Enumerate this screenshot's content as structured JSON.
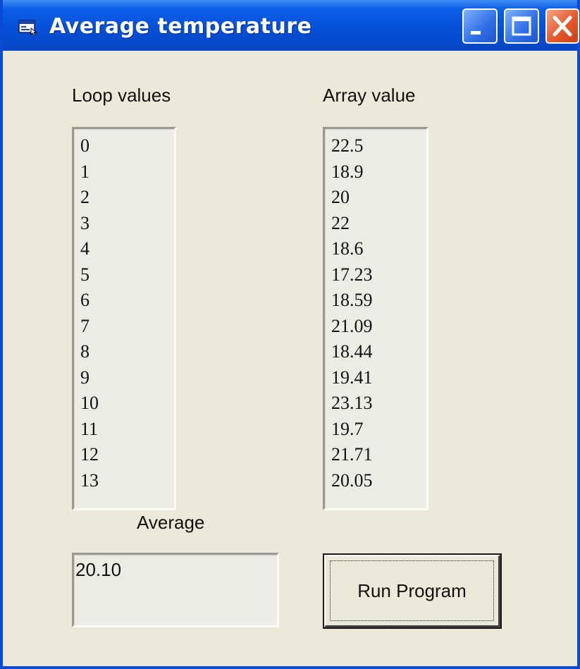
{
  "window": {
    "title": "Average temperature",
    "icons": {
      "app": "app-window-icon",
      "minimize": "minimize-icon",
      "maximize": "maximize-icon",
      "close": "close-icon"
    },
    "colors": {
      "titlebar": "#0650d8",
      "client_background": "#ece9d8",
      "close_button": "#e45a2c"
    }
  },
  "form": {
    "loop_label": "Loop values",
    "array_label": "Array value",
    "average_label": "Average",
    "loop_values": [
      "0",
      "1",
      "2",
      "3",
      "4",
      "5",
      "6",
      "7",
      "8",
      "9",
      "10",
      "11",
      "12",
      "13"
    ],
    "array_values": [
      "22.5",
      "18.9",
      "20",
      "22",
      "18.6",
      "17.23",
      "18.59",
      "21.09",
      "18.44",
      "19.41",
      "23.13",
      "19.7",
      "21.71",
      "20.05"
    ],
    "average_value": "20.10",
    "run_button_label": "Run Program"
  }
}
